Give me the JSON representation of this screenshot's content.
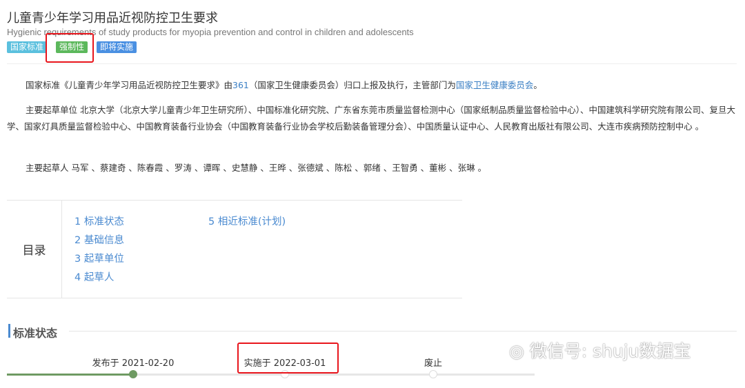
{
  "header": {
    "title": "儿童青少年学习用品近视防控卫生要求",
    "subtitle": "Hygienic requirements of study products for myopia prevention and control in children and adolescents",
    "badges": [
      {
        "label": "国家标准",
        "color": "#5bc0de"
      },
      {
        "label": "强制性",
        "color": "#5cb85c"
      },
      {
        "label": "即将实施",
        "color": "#4a90e2"
      }
    ]
  },
  "intro": {
    "p1_a": "国家标准《儿童青少年学习用品近视防控卫生要求》由",
    "p1_link1": "361",
    "p1_b": "（国家卫生健康委员会）归口上报及执行，主管部门为",
    "p1_link2": "国家卫生健康委员会",
    "p1_c": "。",
    "p2": "主要起草单位 北京大学（北京大学儿童青少年卫生研究所）、中国标准化研究院、广东省东莞市质量监督检测中心（国家纸制品质量监督检验中心）、中国建筑科学研究院有限公司、复旦大学、国家灯具质量监督检验中心、中国教育装备行业协会（中国教育装备行业协会学校后勤装备管理分会）、中国质量认证中心、人民教育出版社有限公司、大连市疾病预防控制中心 。",
    "p3": "主要起草人 马军 、蔡建奇 、陈春霞 、罗涛 、谭晖 、史慧静 、王晔 、张德斌 、陈松 、郭绪 、王智勇 、董彬 、张琳 。"
  },
  "toc": {
    "label": "目录",
    "items": [
      "1 标准状态",
      "2 基础信息",
      "3 起草单位",
      "4 起草人",
      "5 相近标准(计划)"
    ]
  },
  "status": {
    "title": "标准状态",
    "steps": [
      "发布于 2021-02-20",
      "实施于 2022-03-01",
      "废止"
    ],
    "completed_steps": 1,
    "accent": "#6e9a62"
  },
  "watermark": "微信号: shuju数据宝"
}
